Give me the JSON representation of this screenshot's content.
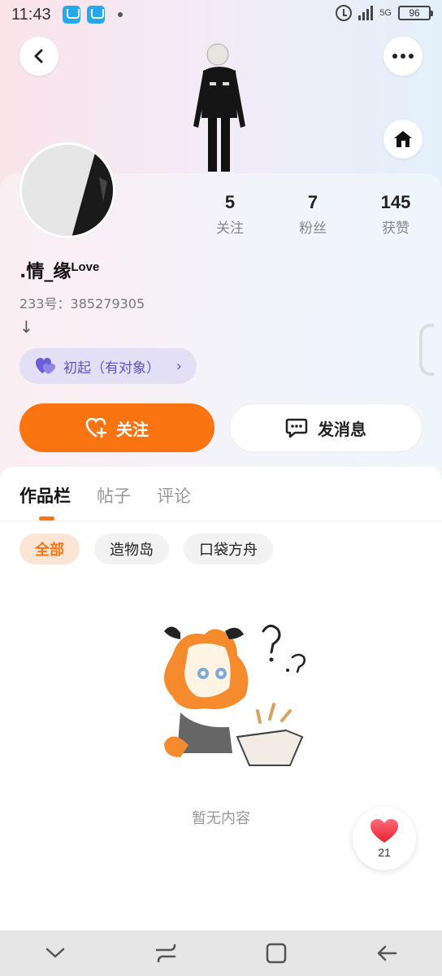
{
  "status_bar": {
    "time": "11:43",
    "network": "5G",
    "battery": "96",
    "icons": [
      "app-store-icon",
      "app-store-icon",
      "notification-dot-icon",
      "alarm-icon",
      "signal-icon",
      "battery-icon"
    ]
  },
  "header": {
    "back_icon": "back-arrow-icon",
    "more_icon": "more-icon",
    "home_icon": "home-icon"
  },
  "profile": {
    "stats": [
      {
        "value": "5",
        "label": "关注"
      },
      {
        "value": "7",
        "label": "粉丝"
      },
      {
        "value": "145",
        "label": "获赞"
      }
    ],
    "name": ".情_缘",
    "name_suffix": "Love",
    "id_text": "233号：385279305",
    "bio": "↓",
    "relation": "初起（有对象）",
    "relation_chevron": "›"
  },
  "actions": {
    "follow": "关注",
    "message": "发消息"
  },
  "tabs": [
    {
      "label": "作品栏",
      "active": true
    },
    {
      "label": "帖子",
      "active": false
    },
    {
      "label": "评论",
      "active": false
    }
  ],
  "chips": [
    {
      "label": "全部",
      "active": true
    },
    {
      "label": "造物岛",
      "active": false
    },
    {
      "label": "口袋方舟",
      "active": false
    }
  ],
  "empty_state": "暂无内容",
  "like_float": {
    "count": "21"
  },
  "colors": {
    "accent": "#fb7412",
    "relation": "#5f54c9"
  }
}
